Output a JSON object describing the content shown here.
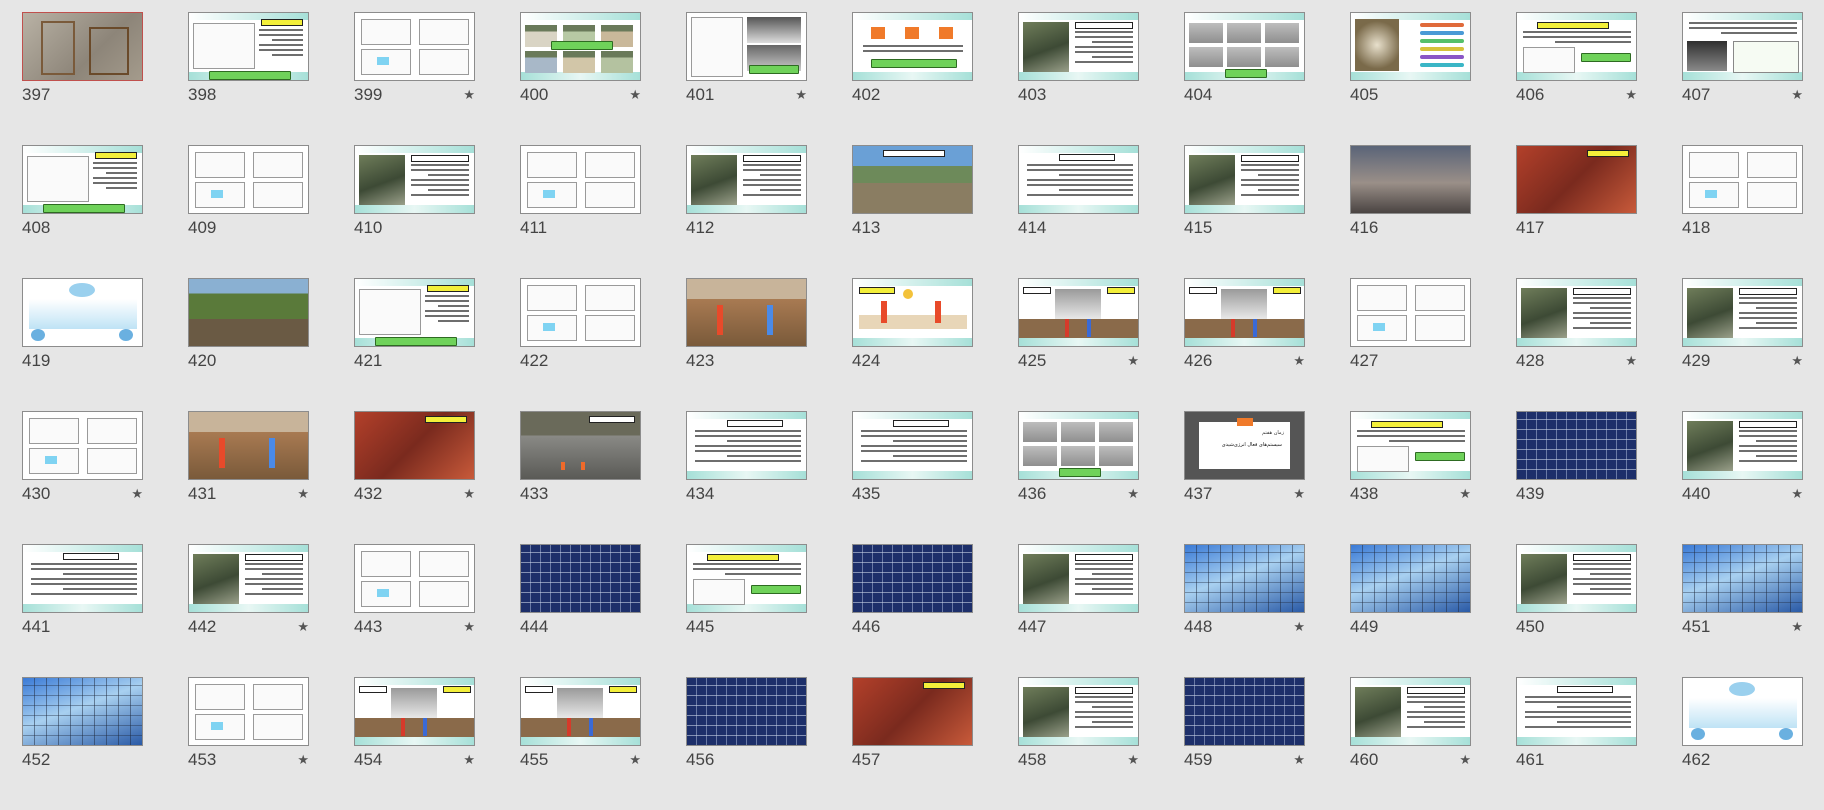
{
  "app": "Slide Sorter",
  "colors": {
    "teal_band": "#a6e0d8",
    "caption_green": "#6fd25a",
    "title_yellow": "#f3ef3a",
    "background": "#e6e6e6"
  },
  "slide_437_text": {
    "line1": "زمان هفتم",
    "line2": "سیستم‌های فعال انرژی‌شیدی"
  },
  "slides": [
    {
      "num": "397",
      "star": false,
      "style": "photo-tan"
    },
    {
      "num": "398",
      "star": false,
      "style": "sketch-text"
    },
    {
      "num": "399",
      "star": true,
      "style": "white-sketch"
    },
    {
      "num": "400",
      "star": true,
      "style": "houses"
    },
    {
      "num": "401",
      "star": true,
      "style": "sketch-dark"
    },
    {
      "num": "402",
      "star": false,
      "style": "orange-squares"
    },
    {
      "num": "403",
      "star": false,
      "style": "photo-text"
    },
    {
      "num": "404",
      "star": false,
      "style": "gray-grid"
    },
    {
      "num": "405",
      "star": false,
      "style": "photo-list"
    },
    {
      "num": "406",
      "star": true,
      "style": "text-diagram"
    },
    {
      "num": "407",
      "star": true,
      "style": "text-photo"
    },
    {
      "num": "408",
      "star": false,
      "style": "sketch-text"
    },
    {
      "num": "409",
      "star": false,
      "style": "white-sketch"
    },
    {
      "num": "410",
      "star": false,
      "style": "photo-text"
    },
    {
      "num": "411",
      "star": false,
      "style": "white-sketch"
    },
    {
      "num": "412",
      "star": false,
      "style": "photo-text"
    },
    {
      "num": "413",
      "star": false,
      "style": "photo-landscape"
    },
    {
      "num": "414",
      "star": false,
      "style": "text-only"
    },
    {
      "num": "415",
      "star": false,
      "style": "photo-text"
    },
    {
      "num": "416",
      "star": false,
      "style": "photo-dusk"
    },
    {
      "num": "417",
      "star": false,
      "style": "photo-red"
    },
    {
      "num": "418",
      "star": false,
      "style": "white-sketch"
    },
    {
      "num": "419",
      "star": false,
      "style": "diagram-blue"
    },
    {
      "num": "420",
      "star": false,
      "style": "photo-green"
    },
    {
      "num": "421",
      "star": false,
      "style": "sketch-text"
    },
    {
      "num": "422",
      "star": false,
      "style": "white-sketch"
    },
    {
      "num": "423",
      "star": false,
      "style": "photo-earth"
    },
    {
      "num": "424",
      "star": false,
      "style": "diagram-arrow"
    },
    {
      "num": "425",
      "star": true,
      "style": "diagram-house"
    },
    {
      "num": "426",
      "star": true,
      "style": "diagram-house"
    },
    {
      "num": "427",
      "star": false,
      "style": "white-sketch"
    },
    {
      "num": "428",
      "star": true,
      "style": "photo-text"
    },
    {
      "num": "429",
      "star": true,
      "style": "photo-text"
    },
    {
      "num": "430",
      "star": true,
      "style": "white-sketch"
    },
    {
      "num": "431",
      "star": true,
      "style": "photo-earth"
    },
    {
      "num": "432",
      "star": true,
      "style": "photo-red"
    },
    {
      "num": "433",
      "star": false,
      "style": "photo-street"
    },
    {
      "num": "434",
      "star": false,
      "style": "text-only"
    },
    {
      "num": "435",
      "star": false,
      "style": "text-only"
    },
    {
      "num": "436",
      "star": true,
      "style": "gray-grid"
    },
    {
      "num": "437",
      "star": true,
      "style": "title-card"
    },
    {
      "num": "438",
      "star": true,
      "style": "text-diagram"
    },
    {
      "num": "439",
      "star": false,
      "style": "photo-solar"
    },
    {
      "num": "440",
      "star": true,
      "style": "photo-text"
    },
    {
      "num": "441",
      "star": false,
      "style": "text-only"
    },
    {
      "num": "442",
      "star": true,
      "style": "photo-text"
    },
    {
      "num": "443",
      "star": true,
      "style": "white-sketch"
    },
    {
      "num": "444",
      "star": false,
      "style": "photo-solar"
    },
    {
      "num": "445",
      "star": false,
      "style": "text-diagram"
    },
    {
      "num": "446",
      "star": false,
      "style": "photo-solar"
    },
    {
      "num": "447",
      "star": false,
      "style": "photo-text"
    },
    {
      "num": "448",
      "star": true,
      "style": "photo-glass"
    },
    {
      "num": "449",
      "star": false,
      "style": "photo-glass"
    },
    {
      "num": "450",
      "star": false,
      "style": "photo-text"
    },
    {
      "num": "451",
      "star": true,
      "style": "photo-glass"
    },
    {
      "num": "452",
      "star": false,
      "style": "photo-glass"
    },
    {
      "num": "453",
      "star": true,
      "style": "white-sketch"
    },
    {
      "num": "454",
      "star": true,
      "style": "diagram-house"
    },
    {
      "num": "455",
      "star": true,
      "style": "diagram-house"
    },
    {
      "num": "456",
      "star": false,
      "style": "photo-solar"
    },
    {
      "num": "457",
      "star": false,
      "style": "photo-red"
    },
    {
      "num": "458",
      "star": true,
      "style": "photo-text"
    },
    {
      "num": "459",
      "star": true,
      "style": "photo-solar"
    },
    {
      "num": "460",
      "star": true,
      "style": "photo-text"
    },
    {
      "num": "461",
      "star": false,
      "style": "text-only"
    },
    {
      "num": "462",
      "star": false,
      "style": "diagram-blue"
    }
  ]
}
